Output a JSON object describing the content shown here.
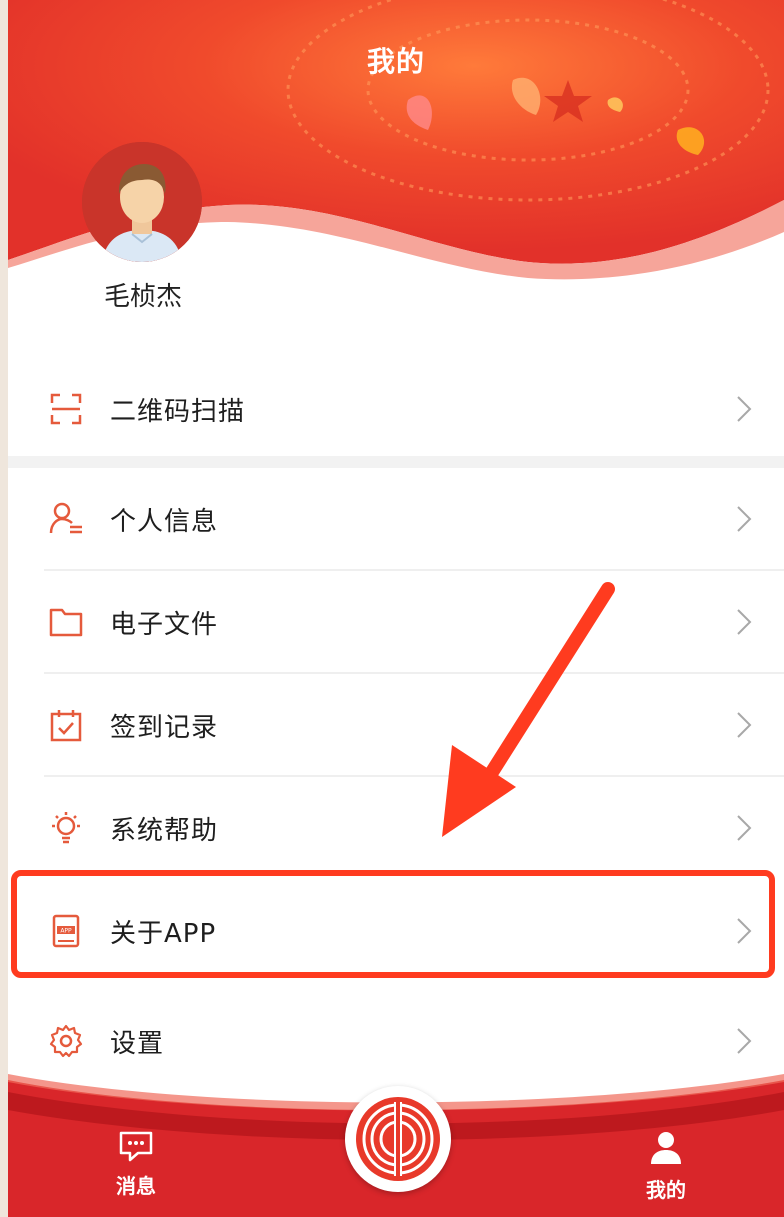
{
  "header": {
    "title": "我的"
  },
  "profile": {
    "name": "毛桢杰"
  },
  "menu": [
    {
      "label": "二维码扫描",
      "icon": "scan-icon"
    },
    {
      "label": "个人信息",
      "icon": "user-info-icon"
    },
    {
      "label": "电子文件",
      "icon": "folder-icon"
    },
    {
      "label": "签到记录",
      "icon": "calendar-check-icon"
    },
    {
      "label": "系统帮助",
      "icon": "lightbulb-icon"
    },
    {
      "label": "关于APP",
      "icon": "app-book-icon",
      "app_badge": "APP"
    },
    {
      "label": "设置",
      "icon": "gear-icon"
    }
  ],
  "tabbar": {
    "messages_label": "消息",
    "mine_label": "我的"
  },
  "colors": {
    "accent": "#e8392a",
    "highlight": "#ff3b1f",
    "icon": "#e55a3c"
  }
}
